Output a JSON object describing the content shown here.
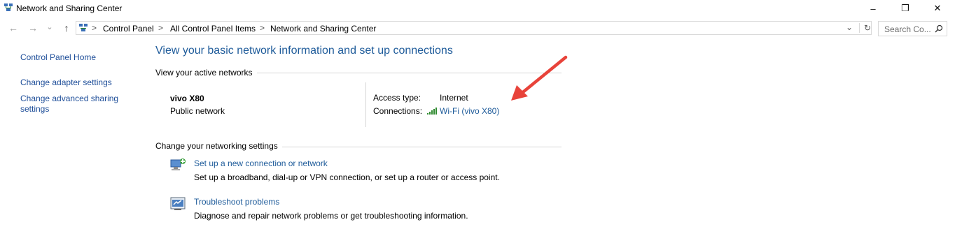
{
  "window": {
    "title": "Network and Sharing Center",
    "icon": "network-center-icon",
    "controls": {
      "minimize": "–",
      "maximize": "❐",
      "close": "✕"
    }
  },
  "address_bar": {
    "back": "←",
    "forward": "→",
    "recent": "⌄",
    "up": "↑",
    "breadcrumbs": [
      "Control Panel",
      "All Control Panel Items",
      "Network and Sharing Center"
    ],
    "separator": ">",
    "dropdown": "⌄",
    "refresh": "↻"
  },
  "search": {
    "placeholder": "Search Co...",
    "icon": "search-icon"
  },
  "sidebar": {
    "items": [
      {
        "label": "Control Panel Home"
      },
      {
        "label": "Change adapter settings"
      },
      {
        "label": "Change advanced sharing settings"
      }
    ]
  },
  "main": {
    "heading": "View your basic network information and set up connections",
    "active_networks_label": "View your active networks",
    "network": {
      "name": "vivo X80",
      "type": "Public network",
      "access_type_label": "Access type:",
      "access_type_value": "Internet",
      "connections_label": "Connections:",
      "connection_link": "Wi-Fi (vivo X80)",
      "connection_icon": "wifi-signal-icon"
    },
    "settings_label": "Change your networking settings",
    "tasks": [
      {
        "icon": "new-connection-icon",
        "title": "Set up a new connection or network",
        "description": "Set up a broadband, dial-up or VPN connection, or set up a router or access point."
      },
      {
        "icon": "troubleshoot-icon",
        "title": "Troubleshoot problems",
        "description": "Diagnose and repair network problems or get troubleshooting information."
      }
    ]
  },
  "annotation": {
    "arrow_color": "#e8433a",
    "icon": "red-arrow-icon"
  }
}
